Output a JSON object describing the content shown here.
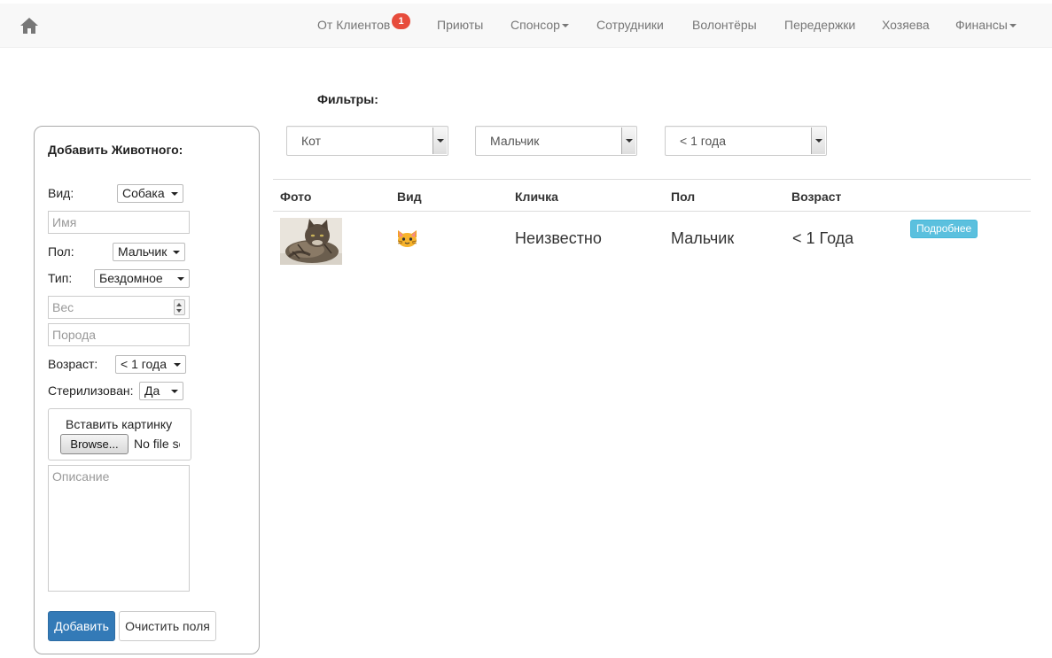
{
  "nav": {
    "items": [
      {
        "label": "От Клиентов",
        "badge": "1"
      },
      {
        "label": "Приюты"
      },
      {
        "label": "Спонсор",
        "dropdown": true
      },
      {
        "label": "Сотрудники"
      },
      {
        "label": "Волонтёры"
      },
      {
        "label": "Передержки"
      },
      {
        "label": "Хозяева"
      },
      {
        "label": "Финансы",
        "dropdown": true
      }
    ]
  },
  "filters": {
    "label": "Фильтры:",
    "species": "Кот",
    "gender": "Мальчик",
    "age": "< 1 года"
  },
  "table": {
    "headers": [
      "Фото",
      "Вид",
      "Кличка",
      "Пол",
      "Возраст"
    ],
    "rows": [
      {
        "species_icon": "cat-icon",
        "name": "Неизвестно",
        "gender": "Мальчик",
        "age": "< 1 Года",
        "details_label": "Подробнее"
      }
    ]
  },
  "add_form": {
    "title": "Добавить Животного:",
    "species_label": "Вид:",
    "species_value": "Собака",
    "name_placeholder": "Имя",
    "gender_label": "Пол:",
    "gender_value": "Мальчик",
    "type_label": "Тип:",
    "type_value": "Бездомное",
    "weight_placeholder": "Вес",
    "breed_placeholder": "Порода",
    "age_label": "Возраст:",
    "age_value": "< 1 года",
    "sterilized_label": "Стерилизован:",
    "sterilized_value": "Да",
    "upload_label": "Вставить картинку",
    "browse_label": "Browse...",
    "no_file_text": "No file selected.",
    "description_placeholder": "Описание",
    "add_button": "Добавить",
    "clear_button": "Очистить поля"
  },
  "colors": {
    "navbar_bg": "#f8f8f8",
    "badge": "#e74c3c",
    "primary": "#337ab7",
    "info": "#5bc0de"
  }
}
